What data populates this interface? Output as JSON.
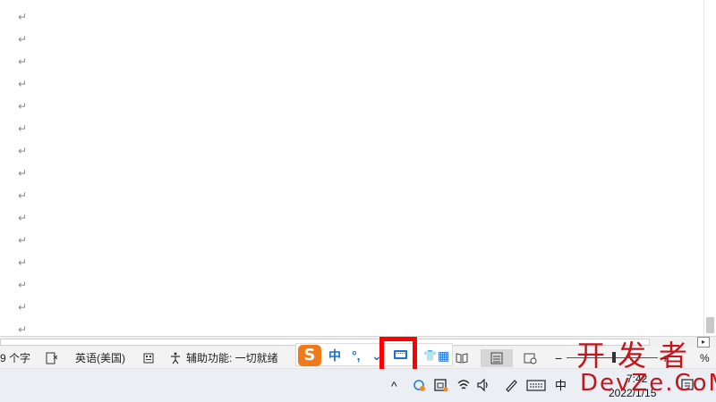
{
  "document": {
    "paragraph_mark": "↵",
    "paragraph_mark_count": 15
  },
  "scrollbar": {
    "right_arrow": "▸"
  },
  "statusbar": {
    "word_count": "9 个字",
    "language": "英语(美国)",
    "accessibility": "辅助功能: 一切就绪",
    "zoom_minus": "−",
    "zoom_plus": "+",
    "zoom_percent": "%"
  },
  "ime": {
    "logo_letter": "S",
    "chinese_mode": "中",
    "punctuation": "°,",
    "tool": "⌄",
    "shirt": "👕",
    "grid": "▦"
  },
  "taskbar": {
    "time": "7:42",
    "date": "2022/1/15",
    "ime_indicator": "中",
    "chevron": "^"
  },
  "watermark": {
    "line1": "开发者",
    "line2": "DevZe.CoM"
  },
  "colors": {
    "highlight": "#ff0000",
    "ime_blue": "#1a6fd1",
    "ime_logo": "#f07a1a",
    "watermark": "#c4151c"
  }
}
